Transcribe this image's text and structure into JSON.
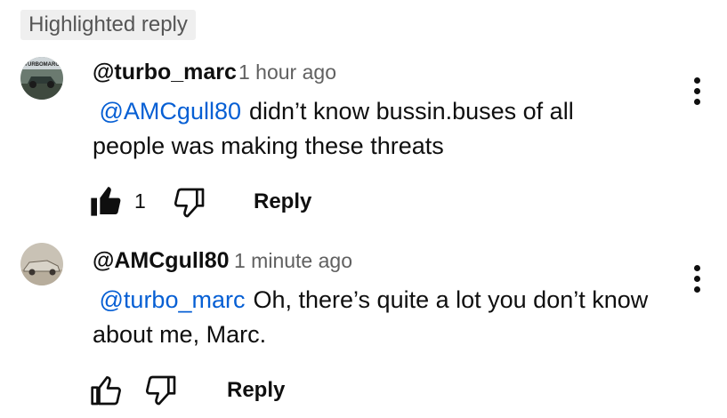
{
  "highlight_label": "Highlighted reply",
  "comments": [
    {
      "handle": "@turbo_marc",
      "time": "1 hour ago",
      "mention": "@AMCgull80",
      "text_line1": "didn’t know bussin.buses of all",
      "text_line2": "people was making these threats",
      "like_count": "1",
      "reply_label": "Reply",
      "avatar_icon": "car-photo-avatar",
      "avatar_text": "TURBOMARC"
    },
    {
      "handle": "@AMCgull80",
      "time": "1 minute ago",
      "mention": "@turbo_marc",
      "text_line1": "Oh, there’s quite a lot you don’t know",
      "text_line2": "about me, Marc.",
      "reply_label": "Reply",
      "avatar_icon": "vintage-car-avatar"
    }
  ],
  "colors": {
    "mention": "#065fd4",
    "chip_bg": "#efefef",
    "meta": "#606060"
  }
}
